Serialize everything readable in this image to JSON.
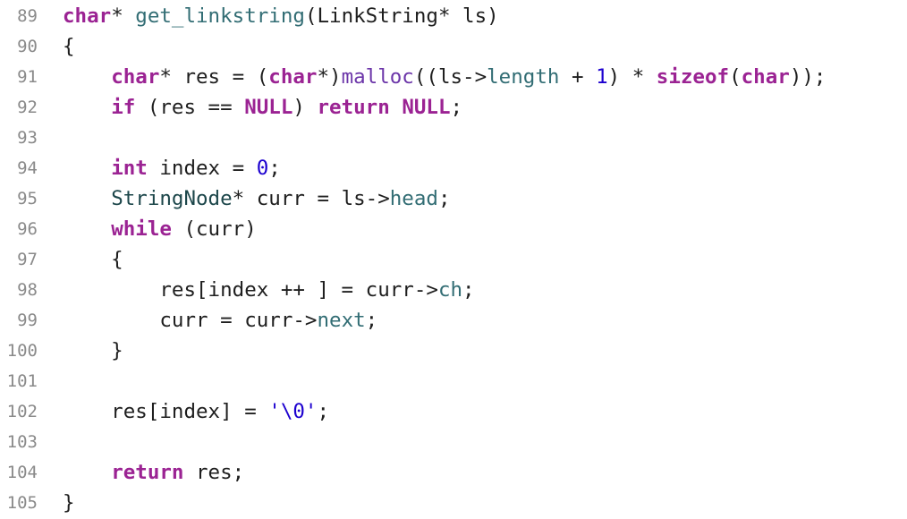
{
  "colors": {
    "background": "#ffffff",
    "line_number": "#8a8a8a",
    "plain": "#1e1e1e",
    "keyword": "#9b2393",
    "function_declaration": "#326d74",
    "library_function": "#6c36a9",
    "type": "#1c464a",
    "number": "#1c00cf",
    "member": "#326d74",
    "macro": "#9b2393"
  },
  "lines": [
    {
      "number": "89",
      "tokens": [
        {
          "t": "char",
          "k": "keyword"
        },
        {
          "t": "* ",
          "k": "plain"
        },
        {
          "t": "get_linkstring",
          "k": "func"
        },
        {
          "t": "(LinkString* ls)",
          "k": "plain"
        }
      ]
    },
    {
      "number": "90",
      "tokens": [
        {
          "t": "{",
          "k": "plain"
        }
      ]
    },
    {
      "number": "91",
      "tokens": [
        {
          "t": "    ",
          "k": "plain"
        },
        {
          "t": "char",
          "k": "keyword"
        },
        {
          "t": "* res = (",
          "k": "plain"
        },
        {
          "t": "char",
          "k": "keyword"
        },
        {
          "t": "*)",
          "k": "plain"
        },
        {
          "t": "malloc",
          "k": "libfunc"
        },
        {
          "t": "((ls->",
          "k": "plain"
        },
        {
          "t": "length",
          "k": "member"
        },
        {
          "t": " + ",
          "k": "plain"
        },
        {
          "t": "1",
          "k": "number"
        },
        {
          "t": ") * ",
          "k": "plain"
        },
        {
          "t": "sizeof",
          "k": "keyword"
        },
        {
          "t": "(",
          "k": "plain"
        },
        {
          "t": "char",
          "k": "keyword"
        },
        {
          "t": "));",
          "k": "plain"
        }
      ]
    },
    {
      "number": "92",
      "tokens": [
        {
          "t": "    ",
          "k": "plain"
        },
        {
          "t": "if",
          "k": "keyword"
        },
        {
          "t": " (res == ",
          "k": "plain"
        },
        {
          "t": "NULL",
          "k": "keyword"
        },
        {
          "t": ") ",
          "k": "plain"
        },
        {
          "t": "return",
          "k": "keyword"
        },
        {
          "t": " ",
          "k": "plain"
        },
        {
          "t": "NULL",
          "k": "keyword"
        },
        {
          "t": ";",
          "k": "plain"
        }
      ]
    },
    {
      "number": "93",
      "tokens": []
    },
    {
      "number": "94",
      "tokens": [
        {
          "t": "    ",
          "k": "plain"
        },
        {
          "t": "int",
          "k": "keyword"
        },
        {
          "t": " index = ",
          "k": "plain"
        },
        {
          "t": "0",
          "k": "number"
        },
        {
          "t": ";",
          "k": "plain"
        }
      ]
    },
    {
      "number": "95",
      "tokens": [
        {
          "t": "    ",
          "k": "plain"
        },
        {
          "t": "StringNode",
          "k": "type"
        },
        {
          "t": "* curr = ls->",
          "k": "plain"
        },
        {
          "t": "head",
          "k": "member"
        },
        {
          "t": ";",
          "k": "plain"
        }
      ]
    },
    {
      "number": "96",
      "tokens": [
        {
          "t": "    ",
          "k": "plain"
        },
        {
          "t": "while",
          "k": "keyword"
        },
        {
          "t": " (curr)",
          "k": "plain"
        }
      ]
    },
    {
      "number": "97",
      "tokens": [
        {
          "t": "    {",
          "k": "plain"
        }
      ]
    },
    {
      "number": "98",
      "tokens": [
        {
          "t": "        res[index ++ ] = curr->",
          "k": "plain"
        },
        {
          "t": "ch",
          "k": "member"
        },
        {
          "t": ";",
          "k": "plain"
        }
      ]
    },
    {
      "number": "99",
      "tokens": [
        {
          "t": "        curr = curr->",
          "k": "plain"
        },
        {
          "t": "next",
          "k": "member"
        },
        {
          "t": ";",
          "k": "plain"
        }
      ]
    },
    {
      "number": "100",
      "tokens": [
        {
          "t": "    }",
          "k": "plain"
        }
      ]
    },
    {
      "number": "101",
      "tokens": []
    },
    {
      "number": "102",
      "tokens": [
        {
          "t": "    res[index] = ",
          "k": "plain"
        },
        {
          "t": "'\\0'",
          "k": "number"
        },
        {
          "t": ";",
          "k": "plain"
        }
      ]
    },
    {
      "number": "103",
      "tokens": []
    },
    {
      "number": "104",
      "tokens": [
        {
          "t": "    ",
          "k": "plain"
        },
        {
          "t": "return",
          "k": "keyword"
        },
        {
          "t": " res;",
          "k": "plain"
        }
      ]
    },
    {
      "number": "105",
      "tokens": [
        {
          "t": "}",
          "k": "plain"
        }
      ]
    }
  ]
}
